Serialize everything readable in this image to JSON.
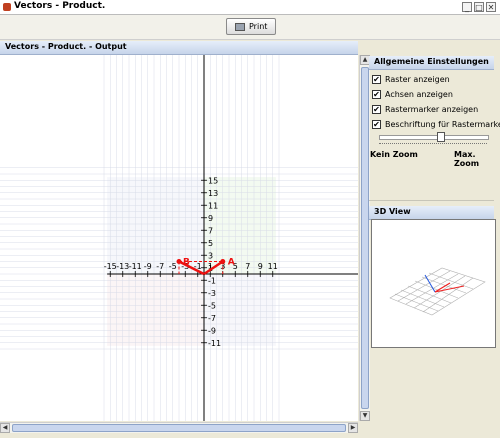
{
  "window": {
    "title": "Vectors - Product."
  },
  "toolbar": {
    "print_label": "Print"
  },
  "output_panel": {
    "title": "Vectors - Product. - Output"
  },
  "settings": {
    "title": "Allgemeine Einstellungen",
    "checkboxes": [
      {
        "label": "Raster anzeigen",
        "checked": true
      },
      {
        "label": "Achsen anzeigen",
        "checked": true
      },
      {
        "label": "Rastermarker anzeigen",
        "checked": true
      },
      {
        "label": "Beschriftung für Rastermarker",
        "checked": true
      }
    ],
    "zoom_min_label": "Kein Zoom",
    "zoom_max_label": "Max. Zoom",
    "zoom_level": 0.55
  },
  "view3d": {
    "title": "3D View"
  },
  "plot": {
    "x_ticks": [
      "-15",
      "-13",
      "-11",
      "-9",
      "-7",
      "-5",
      "-3",
      "-1",
      "1",
      "3",
      "5",
      "7",
      "9",
      "11"
    ],
    "y_ticks": [
      "15",
      "13",
      "11",
      "9",
      "7",
      "5",
      "3",
      "1",
      "-1",
      "-3",
      "-5",
      "-7",
      "-9",
      "-11"
    ],
    "vector_a": {
      "label": "A",
      "x": 3,
      "y": 2
    },
    "vector_b": {
      "label": "B",
      "x": -4,
      "y": 2
    },
    "colors": {
      "vector": "#ee1111",
      "grid": "#d8dce8",
      "axis": "#000000"
    }
  }
}
